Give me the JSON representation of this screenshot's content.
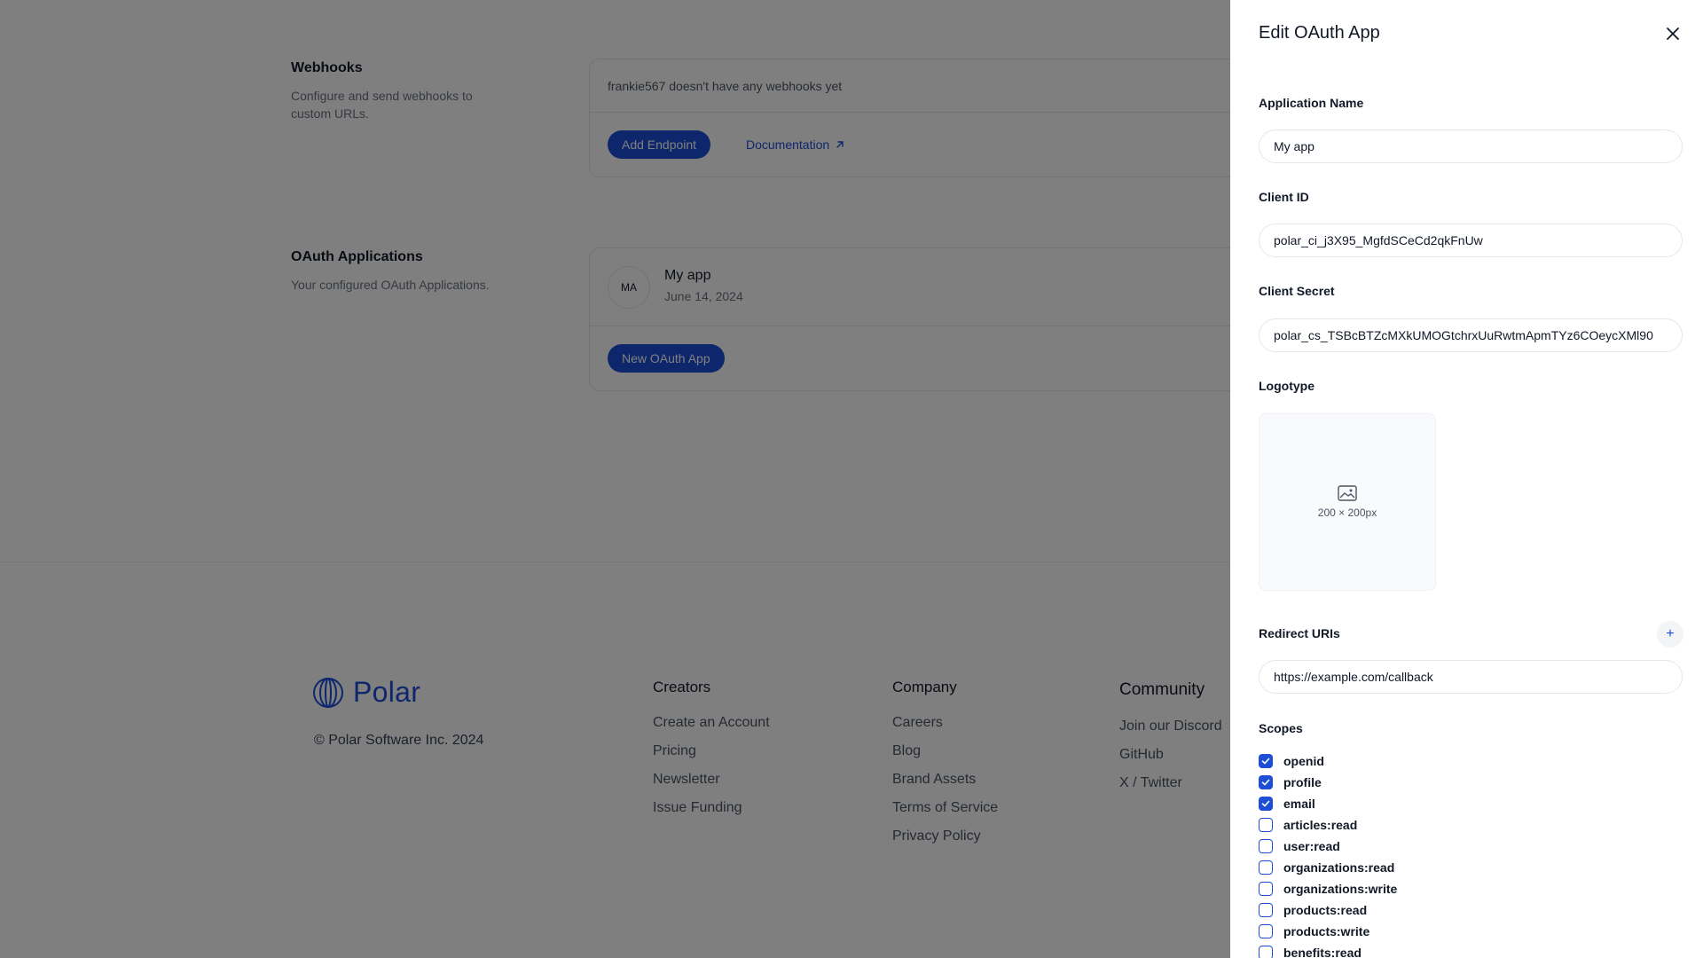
{
  "webhooks": {
    "title": "Webhooks",
    "description": "Configure and send webhooks to custom URLs.",
    "empty_text": "frankie567 doesn't have any webhooks yet",
    "add_endpoint_label": "Add Endpoint",
    "documentation_label": "Documentation"
  },
  "oauth": {
    "title": "OAuth Applications",
    "description": "Your configured OAuth Applications.",
    "app": {
      "initials": "MA",
      "name": "My app",
      "date": "June 14, 2024"
    },
    "new_app_label": "New OAuth App"
  },
  "footer": {
    "logo_text": "Polar",
    "copyright": "© Polar Software Inc. 2024",
    "columns": [
      {
        "title": "Creators",
        "links": [
          "Create an Account",
          "Pricing",
          "Newsletter",
          "Issue Funding"
        ]
      },
      {
        "title": "Company",
        "links": [
          "Careers",
          "Blog",
          "Brand Assets",
          "Terms of Service",
          "Privacy Policy"
        ]
      },
      {
        "title": "Community",
        "links": [
          "Join our Discord",
          "GitHub",
          "X / Twitter"
        ]
      }
    ]
  },
  "drawer": {
    "title": "Edit OAuth App",
    "application_name": {
      "label": "Application Name",
      "value": "My app"
    },
    "client_id": {
      "label": "Client ID",
      "value": "polar_ci_j3X95_MgfdSCeCd2qkFnUw"
    },
    "client_secret": {
      "label": "Client Secret",
      "value": "polar_cs_TSBcBTZcMXkUMOGtchrxUuRwtmApmTYz6COeycXMl90"
    },
    "logotype": {
      "label": "Logotype",
      "size_hint": "200 × 200px"
    },
    "redirect_uris": {
      "label": "Redirect URIs",
      "add_label": "+",
      "values": [
        "https://example.com/callback"
      ]
    },
    "scopes": {
      "label": "Scopes",
      "items": [
        {
          "name": "openid",
          "checked": true
        },
        {
          "name": "profile",
          "checked": true
        },
        {
          "name": "email",
          "checked": true
        },
        {
          "name": "articles:read",
          "checked": false
        },
        {
          "name": "user:read",
          "checked": false
        },
        {
          "name": "organizations:read",
          "checked": false
        },
        {
          "name": "organizations:write",
          "checked": false
        },
        {
          "name": "products:read",
          "checked": false
        },
        {
          "name": "products:write",
          "checked": false
        },
        {
          "name": "benefits:read",
          "checked": false
        }
      ]
    }
  },
  "colors": {
    "accent": "#1d4ed8",
    "overlay": "#000000"
  }
}
